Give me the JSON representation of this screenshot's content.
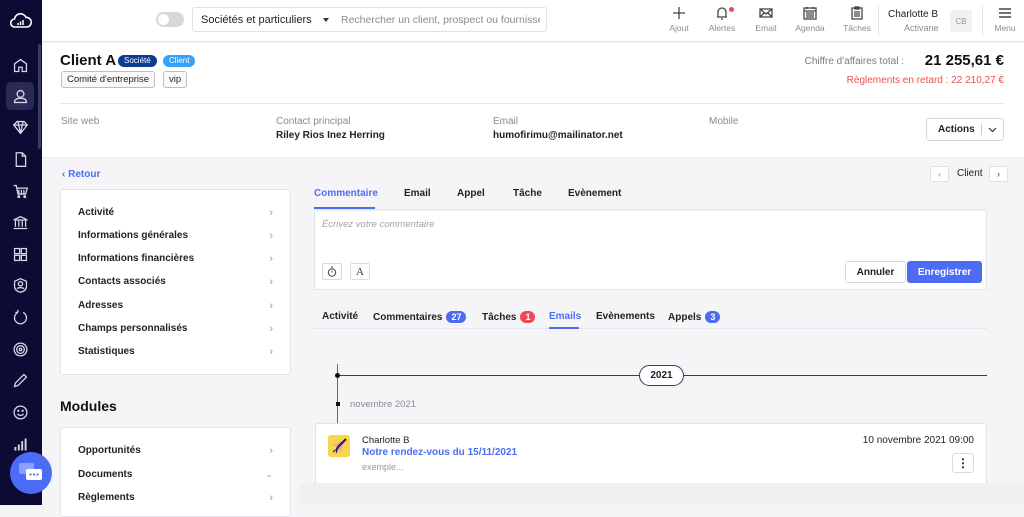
{
  "topbar": {
    "filter_select": "Sociétés et particuliers",
    "search_placeholder": "Rechercher un client, prospect ou fournisseur",
    "buttons": [
      {
        "icon": "plus-icon",
        "label": "Ajout"
      },
      {
        "icon": "bell-icon",
        "label": "Alertes",
        "has_notification": true
      },
      {
        "icon": "mail-icon",
        "label": "Email"
      },
      {
        "icon": "calendar-icon",
        "label": "Agenda"
      },
      {
        "icon": "clipboard-icon",
        "label": "Tâches"
      }
    ],
    "user": {
      "name": "Charlotte B",
      "company": "Activane",
      "initials": "CB"
    },
    "menu_label": "Menu"
  },
  "sidebar": {
    "items": [
      "home-icon",
      "user-icon",
      "diamond-icon",
      "document-icon",
      "cart-icon",
      "bank-icon",
      "grid-icon",
      "badge-icon",
      "refresh-icon",
      "target-icon",
      "pencil-icon",
      "smiley-icon",
      "chart-icon"
    ],
    "active_index": 1
  },
  "client": {
    "name": "Client A",
    "badges": [
      {
        "label": "Société",
        "color": "#0a3d91"
      },
      {
        "label": "Client",
        "color": "#3aa0f5"
      }
    ],
    "tags": [
      "Comité d'entreprise",
      "vip"
    ],
    "revenue_label": "Chiffre d'affaires total :",
    "revenue_value": "21 255,61 €",
    "late_payments": "Règlements en retard : 22 210,27 €",
    "fields": [
      {
        "label": "Site web",
        "value": ""
      },
      {
        "label": "Contact principal",
        "value": "Riley Rios Inez Herring"
      },
      {
        "label": "Email",
        "value": "humofirimu@mailinator.net"
      },
      {
        "label": "Mobile",
        "value": ""
      }
    ],
    "actions_label": "Actions"
  },
  "left_panel": {
    "back_label": "Retour",
    "menu": [
      "Activité",
      "Informations générales",
      "Informations financières",
      "Contacts associés",
      "Adresses",
      "Champs personnalisés",
      "Statistiques"
    ],
    "modules_title": "Modules",
    "modules": [
      {
        "label": "Opportunités",
        "chevron": "right"
      },
      {
        "label": "Documents",
        "chevron": "down"
      },
      {
        "label": "Règlements",
        "chevron": "right"
      }
    ]
  },
  "client_nav": {
    "label": "Client"
  },
  "compose": {
    "tabs": [
      "Commentaire",
      "Email",
      "Appel",
      "Tâche",
      "Evènement"
    ],
    "active_tab": 0,
    "placeholder": "Écrivez votre commentaire",
    "cancel_label": "Annuler",
    "save_label": "Enregistrer"
  },
  "activity_tabs": [
    {
      "label": "Activité"
    },
    {
      "label": "Commentaires",
      "count": "27",
      "count_color": "#4d6cf5"
    },
    {
      "label": "Tâches",
      "count": "1",
      "count_color": "#f04a58"
    },
    {
      "label": "Emails",
      "active": true
    },
    {
      "label": "Evènements"
    },
    {
      "label": "Appels",
      "count": "3",
      "count_color": "#4d6cf5"
    }
  ],
  "timeline": {
    "year": "2021",
    "month": "novembre 2021",
    "entries": [
      {
        "author": "Charlotte B",
        "subject": "Notre rendez-vous du 15/11/2021",
        "preview": "exemple...",
        "date": "10 novembre 2021 09:00"
      }
    ]
  },
  "colors": {
    "accent": "#4d6cf5",
    "sidebar": "#0b0b33",
    "danger": "#ef4e4e"
  }
}
